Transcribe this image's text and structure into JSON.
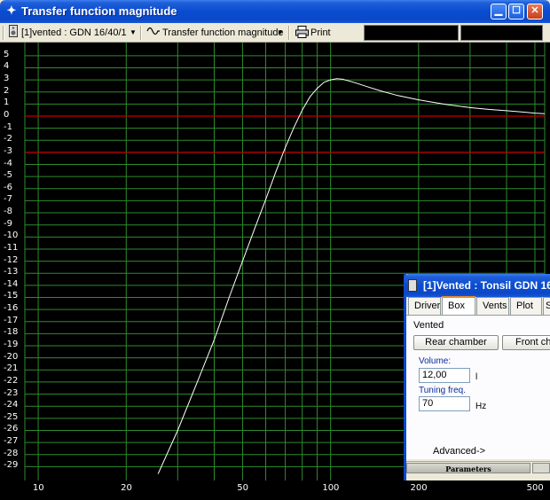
{
  "window": {
    "icon": "crosshair-icon",
    "title": "Transfer function magnitude",
    "buttons": {
      "minimize": "_",
      "maximize": "□",
      "close": "✕"
    }
  },
  "toolbar": {
    "project_selector": "[1]vented : GDN 16/40/1",
    "chart_icon": "wave-icon",
    "chart_selector": "Transfer function magnitude",
    "print_icon": "printer-icon",
    "print_label": "Print"
  },
  "chart_data": {
    "type": "line",
    "xscale": "log",
    "xlim": [
      9,
      540
    ],
    "ylim": [
      -30,
      5.5
    ],
    "x_ticks": [
      10,
      20,
      50,
      100,
      200,
      500
    ],
    "y_ticks": [
      5,
      4,
      3,
      2,
      1,
      0,
      -1,
      -2,
      -3,
      -4,
      -5,
      -6,
      -7,
      -8,
      -9,
      -10,
      -11,
      -12,
      -13,
      -14,
      -15,
      -16,
      -17,
      -18,
      -19,
      -20,
      -21,
      -22,
      -23,
      -24,
      -25,
      -26,
      -27,
      -28,
      -29
    ],
    "reference_lines": [
      {
        "y": 0,
        "color": "#c00000"
      },
      {
        "y": -3,
        "color": "#c00000"
      }
    ],
    "grid": true,
    "grid_color": "#2e8b2e",
    "series": [
      {
        "color": "#ffffff",
        "points": [
          [
            25.7,
            -29.6
          ],
          [
            30,
            -26
          ],
          [
            35,
            -22
          ],
          [
            40,
            -18.5
          ],
          [
            45,
            -15
          ],
          [
            50,
            -12
          ],
          [
            55,
            -9.3
          ],
          [
            60,
            -6.9
          ],
          [
            65,
            -4.6
          ],
          [
            70,
            -2.6
          ],
          [
            75,
            -0.9
          ],
          [
            80,
            0.5
          ],
          [
            85,
            1.6
          ],
          [
            90,
            2.3
          ],
          [
            95,
            2.8
          ],
          [
            100,
            3.0
          ],
          [
            105,
            3.1
          ],
          [
            110,
            3.05
          ],
          [
            120,
            2.8
          ],
          [
            135,
            2.4
          ],
          [
            150,
            2.05
          ],
          [
            170,
            1.7
          ],
          [
            200,
            1.35
          ],
          [
            250,
            0.95
          ],
          [
            300,
            0.7
          ],
          [
            350,
            0.55
          ],
          [
            400,
            0.45
          ],
          [
            450,
            0.35
          ],
          [
            500,
            0.25
          ],
          [
            540,
            0.2
          ]
        ]
      }
    ]
  },
  "dialog": {
    "icon": "speaker-icon",
    "title": "[1]Vented : Tonsil GDN 16",
    "tabs": [
      "Driver",
      "Box",
      "Vents",
      "Plot",
      "S"
    ],
    "active_tab": "Box",
    "section": "Vented",
    "rear_button": "Rear chamber",
    "front_button": "Front cha",
    "volume_label": "Volume:",
    "volume_value": "12,00",
    "volume_unit": "l",
    "tuning_label": "Tuning freq.",
    "tuning_value": "70",
    "tuning_unit": "Hz",
    "advanced": "Advanced->",
    "status_panel": "Parameters"
  }
}
